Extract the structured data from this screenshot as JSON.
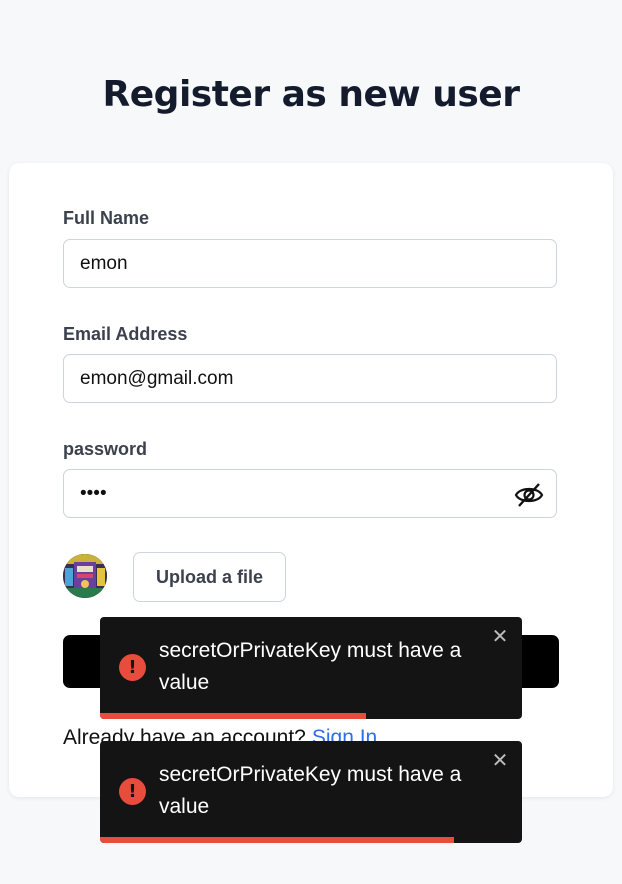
{
  "page": {
    "title": "Register as new user"
  },
  "form": {
    "full_name": {
      "label": "Full Name",
      "value": "emon"
    },
    "email": {
      "label": "Email Address",
      "value": "emon@gmail.com"
    },
    "password": {
      "label": "password",
      "value": "••••",
      "toggle_icon": "eye-slash-icon"
    },
    "avatar_icon": "avatar-image",
    "upload_label": "Upload a file",
    "submit_label": ""
  },
  "footer": {
    "prompt": "Already have an account?",
    "link": "Sign In"
  },
  "toasts": [
    {
      "icon": "error-icon",
      "icon_glyph": "!",
      "message": "secretOrPrivateKey must have a value",
      "close": "✕",
      "progress": 0.63
    },
    {
      "icon": "error-icon",
      "icon_glyph": "!",
      "message": "secretOrPrivateKey must have a value",
      "close": "✕",
      "progress": 0.84
    }
  ],
  "colors": {
    "background": "#f7f8fa",
    "title": "#141b2d",
    "link": "#2f6fe0",
    "toast_bg": "#141414",
    "error": "#e74c3c"
  }
}
